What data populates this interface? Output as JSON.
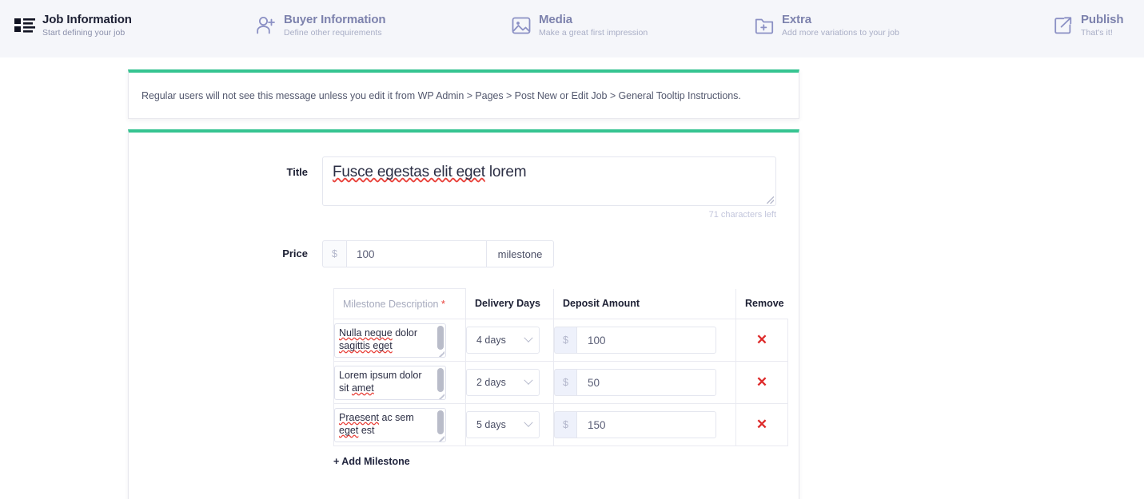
{
  "steps": [
    {
      "icon": "list-grid-icon",
      "title": "Job Information",
      "subtitle": "Start defining your job",
      "active": true
    },
    {
      "icon": "add-user-icon",
      "title": "Buyer Information",
      "subtitle": "Define other requirements",
      "active": false
    },
    {
      "icon": "image-icon",
      "title": "Media",
      "subtitle": "Make a great first impression",
      "active": false
    },
    {
      "icon": "folder-plus-icon",
      "title": "Extra",
      "subtitle": "Add more variations to your job",
      "active": false
    },
    {
      "icon": "external-link-icon",
      "title": "Publish",
      "subtitle": "That's it!",
      "active": false
    }
  ],
  "notice": {
    "text": "Regular users will not see this message unless you edit it from WP Admin > Pages > Post New or Edit Job > General Tooltip Instructions."
  },
  "form": {
    "title_label": "Title",
    "title_value_spell": "Fusce egestas elit eget",
    "title_value_rest": " lorem",
    "characters_left": "71 characters left",
    "price_label": "Price",
    "price_currency": "$",
    "price_value": "100",
    "price_unit": "milestone",
    "add_milestone": "+ Add Milestone"
  },
  "milestone_table": {
    "headers": {
      "description": "Milestone Description",
      "description_required": "*",
      "delivery_days": "Delivery Days",
      "deposit_amount": "Deposit Amount",
      "remove": "Remove"
    },
    "rows": [
      {
        "desc_spell": "Nulla neque",
        "desc_rest": " dolor ",
        "desc_spell2": "sagittis eget",
        "desc_rest2": "",
        "days": "4 days",
        "currency": "$",
        "amount": "100",
        "remove": "✕"
      },
      {
        "desc_spell": "",
        "desc_rest": "Lorem ipsum dolor sit ",
        "desc_spell2": "amet",
        "desc_rest2": "",
        "days": "2 days",
        "currency": "$",
        "amount": "50",
        "remove": "✕"
      },
      {
        "desc_spell": "Praesent",
        "desc_rest": " ac sem ",
        "desc_spell2": "eget",
        "desc_rest2": " est",
        "days": "5 days",
        "currency": "$",
        "amount": "150",
        "remove": "✕"
      }
    ]
  },
  "colors": {
    "accent_green": "#35c491",
    "header_bg": "#f5f6fa",
    "step_inactive": "#7d82ad",
    "remove_red": "#de2b2b"
  }
}
